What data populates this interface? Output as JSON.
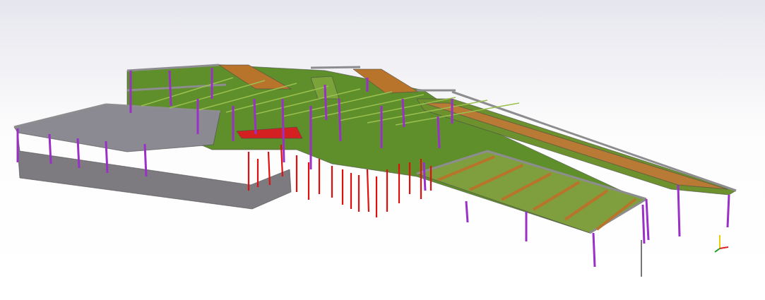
{
  "viewport": {
    "show_axes": true
  }
}
